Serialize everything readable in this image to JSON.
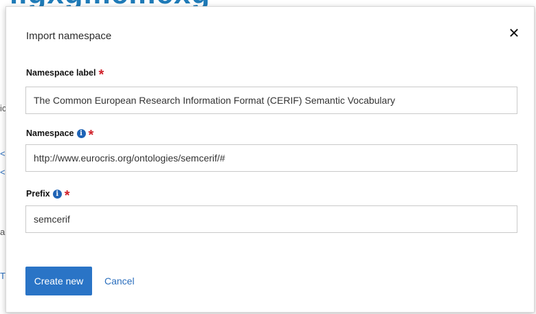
{
  "background": {
    "heading_fragment": "ilgxgmcmcxg"
  },
  "modal": {
    "title": "Import namespace",
    "close_icon": "close-icon",
    "fields": [
      {
        "label": "Namespace label",
        "info": false,
        "required": true,
        "value": "The Common European Research Information Format (CERIF) Semantic Vocabulary"
      },
      {
        "label": "Namespace",
        "info": true,
        "required": true,
        "value": "http://www.eurocris.org/ontologies/semcerif/#"
      },
      {
        "label": "Prefix",
        "info": true,
        "required": true,
        "value": "semcerif"
      }
    ],
    "buttons": {
      "create_label": "Create new",
      "cancel_label": "Cancel"
    }
  },
  "colors": {
    "primary": "#2a74c6",
    "required": "#d0212a",
    "info": "#1f63b5"
  }
}
